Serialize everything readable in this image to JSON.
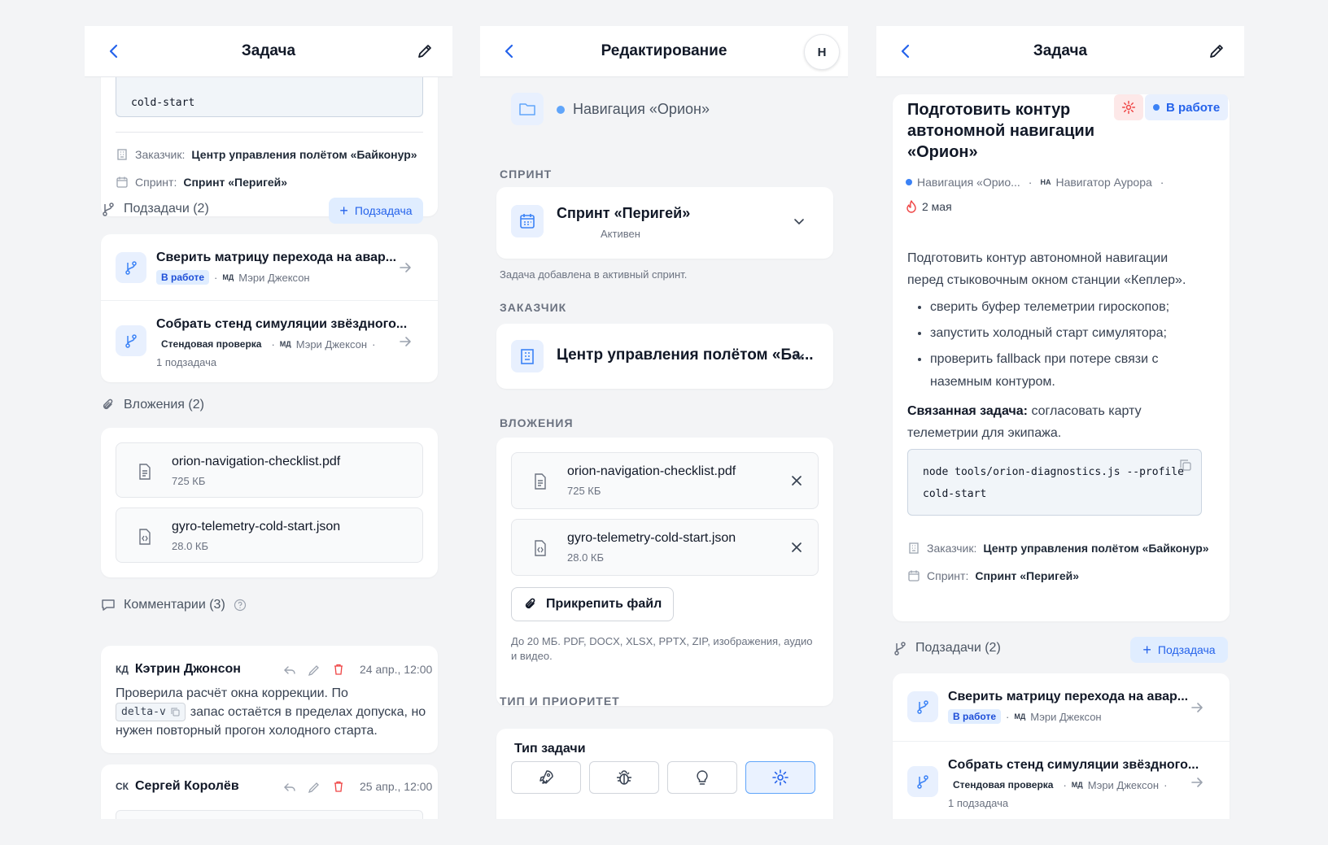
{
  "colors": {
    "accent": "#2563eb",
    "status_in_progress": "#3b82f6",
    "deadline": "#ef4444"
  },
  "p1": {
    "title": "Задача",
    "code_tail": "cold-start",
    "customer_label": "Заказчик:",
    "customer": "Центр управления полётом «Байконур»",
    "sprint_label": "Спринт:",
    "sprint": "Спринт «Перигей»",
    "subtasks_header": "Подзадачи (2)",
    "add_subtask": "Подзадача",
    "subtasks": [
      {
        "title": "Сверить матрицу перехода на авар...",
        "status": "В работе",
        "assignee_initials": "МД",
        "assignee": "Мэри Джексон",
        "extra": ""
      },
      {
        "title": "Собрать стенд симуляции звёздного...",
        "status": "Стендовая проверка",
        "assignee_initials": "МД",
        "assignee": "Мэри Джексон",
        "extra": "1 подзадача"
      }
    ],
    "attachments_header": "Вложения (2)",
    "attachments": [
      {
        "name": "orion-navigation-checklist.pdf",
        "size": "725 КБ",
        "icon": "document-icon"
      },
      {
        "name": "gyro-telemetry-cold-start.json",
        "size": "28.0 КБ",
        "icon": "code-file-icon"
      }
    ],
    "comments_header": "Комментарии (3)",
    "comments": [
      {
        "initials": "КД",
        "author": "Кэтрин Джонсон",
        "date": "24 апр., 12:00",
        "text_before": "Проверила расчёт окна коррекции. По",
        "code": "delta-v",
        "text_after": "запас остаётся в пределах допуска, но",
        "text_line3": "нужен повторный прогон холодного старта."
      },
      {
        "initials": "СК",
        "author": "Сергей Королёв",
        "date": "25 апр., 12:00"
      }
    ]
  },
  "p2": {
    "title": "Редактирование",
    "avatar": "Н",
    "project": "Навигация «Орион»",
    "sprint_section": "СПРИНТ",
    "sprint_name": "Спринт «Перигей»",
    "sprint_status": "Активен",
    "sprint_hint": "Задача добавлена в активный спринт.",
    "customer_section": "ЗАКАЗЧИК",
    "customer_value": "Центр управления полётом «Ба...",
    "attachments_section": "ВЛОЖЕНИЯ",
    "attachments": [
      {
        "name": "orion-navigation-checklist.pdf",
        "size": "725 КБ",
        "icon": "document-icon"
      },
      {
        "name": "gyro-telemetry-cold-start.json",
        "size": "28.0 КБ",
        "icon": "code-file-icon"
      }
    ],
    "attach_button": "Прикрепить файл",
    "attach_hint_1": "До 20 МБ. PDF, DOCX, XLSX, PPTX, ZIP, изображения, аудио",
    "attach_hint_2": "и видео.",
    "type_section": "ТИП И ПРИОРИТЕТ",
    "type_label": "Тип задачи",
    "type_options": [
      "rocket-icon",
      "bug-icon",
      "lightbulb-icon",
      "gear-icon"
    ],
    "selected_type": "gear-icon"
  },
  "p3": {
    "title": "Задача",
    "task_title_1": "Подготовить контур",
    "task_title_2": "автономной навигации",
    "task_title_3": "«Орион»",
    "status": "В работе",
    "project": "Навигация «Орио...",
    "assignee_initials": "НА",
    "assignee": "Навигатор Аурора",
    "deadline": "2 мая",
    "desc_1": "Подготовить контур автономной навигации",
    "desc_2": "перед стыковочным окном станции «Кеплер».",
    "bullets": [
      "сверить буфер телеметрии гироскопов;",
      "запустить холодный старт симулятора;",
      "проверить fallback при потере связи с",
      "наземным контуром."
    ],
    "related_label": "Связанная задача:",
    "related_text": "согласовать карту",
    "related_text_2": "телеметрии для экипажа.",
    "code_line_1": "node tools/orion-diagnostics.js --profile",
    "code_line_2": "cold-start",
    "customer_label": "Заказчик:",
    "customer": "Центр управления полётом «Байконур»",
    "sprint_label": "Спринт:",
    "sprint": "Спринт «Перигей»",
    "subtasks_header": "Подзадачи (2)",
    "add_subtask": "Подзадача",
    "subtasks": [
      {
        "title": "Сверить матрицу перехода на авар...",
        "status": "В работе",
        "assignee_initials": "МД",
        "assignee": "Мэри Джексон",
        "extra": ""
      },
      {
        "title": "Собрать стенд симуляции звёздного...",
        "status": "Стендовая проверка",
        "assignee_initials": "МД",
        "assignee": "Мэри Джексон",
        "extra": "1 подзадача"
      }
    ]
  }
}
